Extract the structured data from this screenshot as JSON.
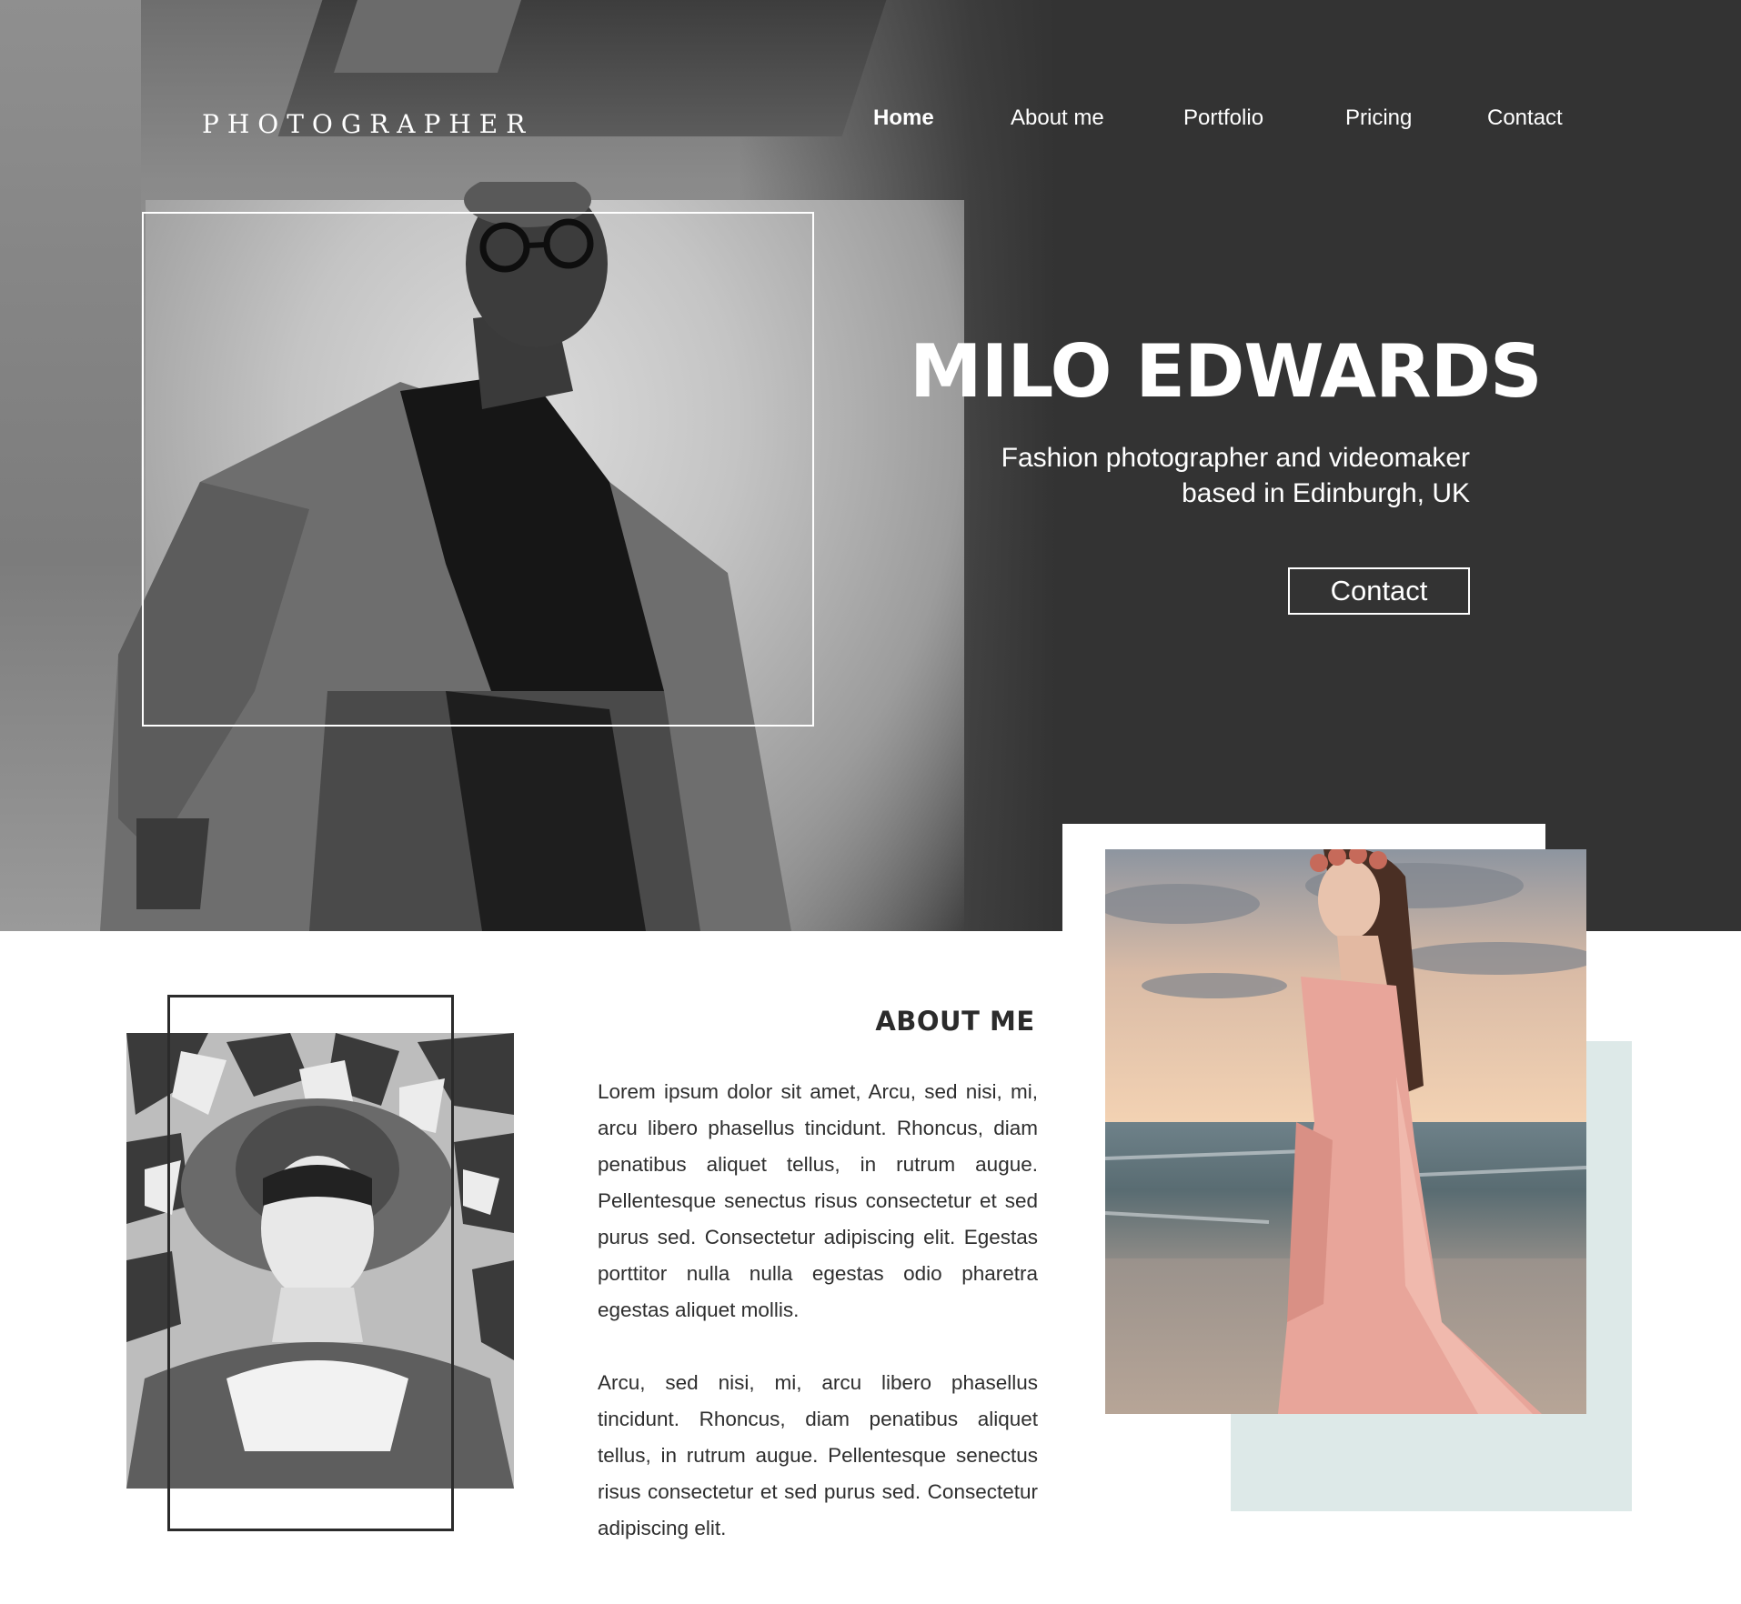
{
  "header": {
    "logo": "PHOTOGRAPHER",
    "nav": [
      {
        "label": "Home",
        "active": true
      },
      {
        "label": "About me",
        "active": false
      },
      {
        "label": "Portfolio",
        "active": false
      },
      {
        "label": "Pricing",
        "active": false
      },
      {
        "label": "Contact",
        "active": false
      }
    ]
  },
  "hero": {
    "title": "MILO EDWARDS",
    "subtitle_line1": "Fashion photographer and videomaker",
    "subtitle_line2": "based in Edinburgh, UK",
    "cta_label": "Contact"
  },
  "about": {
    "heading": "ABOUT ME",
    "paragraph1": "Lorem ipsum dolor sit amet, Arcu, sed nisi, mi, arcu libero phasellus tincidunt. Rhoncus, diam penatibus aliquet tellus, in rutrum augue. Pellentesque senectus risus consectetur et sed purus sed. Consectetur adipiscing elit. Egestas porttitor nulla nulla egestas odio pharetra egestas aliquet mollis.",
    "paragraph2": "Arcu, sed nisi, mi, arcu libero phasellus tincidunt. Rhoncus, diam penatibus aliquet tellus, in rutrum augue. Pellentesque senectus risus consectetur et sed purus sed. Consectetur adipiscing elit."
  },
  "colors": {
    "hero_background": "#333333",
    "accent_mint": "#dde9e8",
    "text_dark": "#2b2b2b",
    "white": "#ffffff"
  }
}
